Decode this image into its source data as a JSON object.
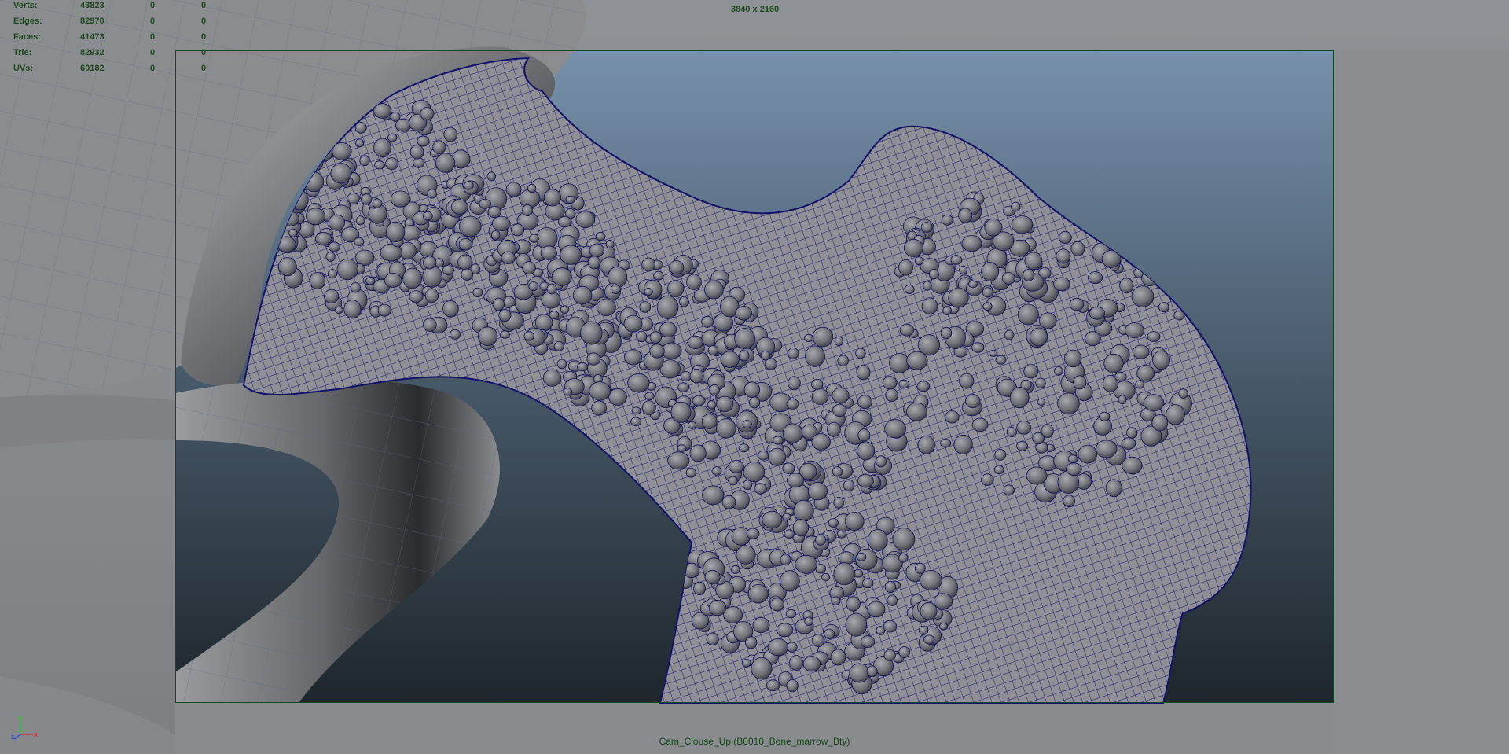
{
  "hud": {
    "rows": [
      {
        "label": "Verts:",
        "v1": "43823",
        "v2": "0",
        "v3": "0"
      },
      {
        "label": "Edges:",
        "v1": "82970",
        "v2": "0",
        "v3": "0"
      },
      {
        "label": "Faces:",
        "v1": "41473",
        "v2": "0",
        "v3": "0"
      },
      {
        "label": "Tris:",
        "v1": "82932",
        "v2": "0",
        "v3": "0"
      },
      {
        "label": "UVs:",
        "v1": "60182",
        "v2": "0",
        "v3": "0"
      }
    ]
  },
  "resolution_gate": "3840 x 2160",
  "camera_name": "Cam_Clouse_Up (B0010_Bone_marrow_Bty)",
  "axis": {
    "x": "x",
    "y": "y",
    "z": "z"
  },
  "colors": {
    "hud_text": "#1f4a1f",
    "wireframe": "#14146e",
    "bone_fill": "#8d8d92",
    "gate_border": "#0e4a22",
    "background_top": "#6f8aa6",
    "background_bottom": "#1f272d"
  },
  "icons": {
    "axis": "axis-gizmo-icon"
  }
}
